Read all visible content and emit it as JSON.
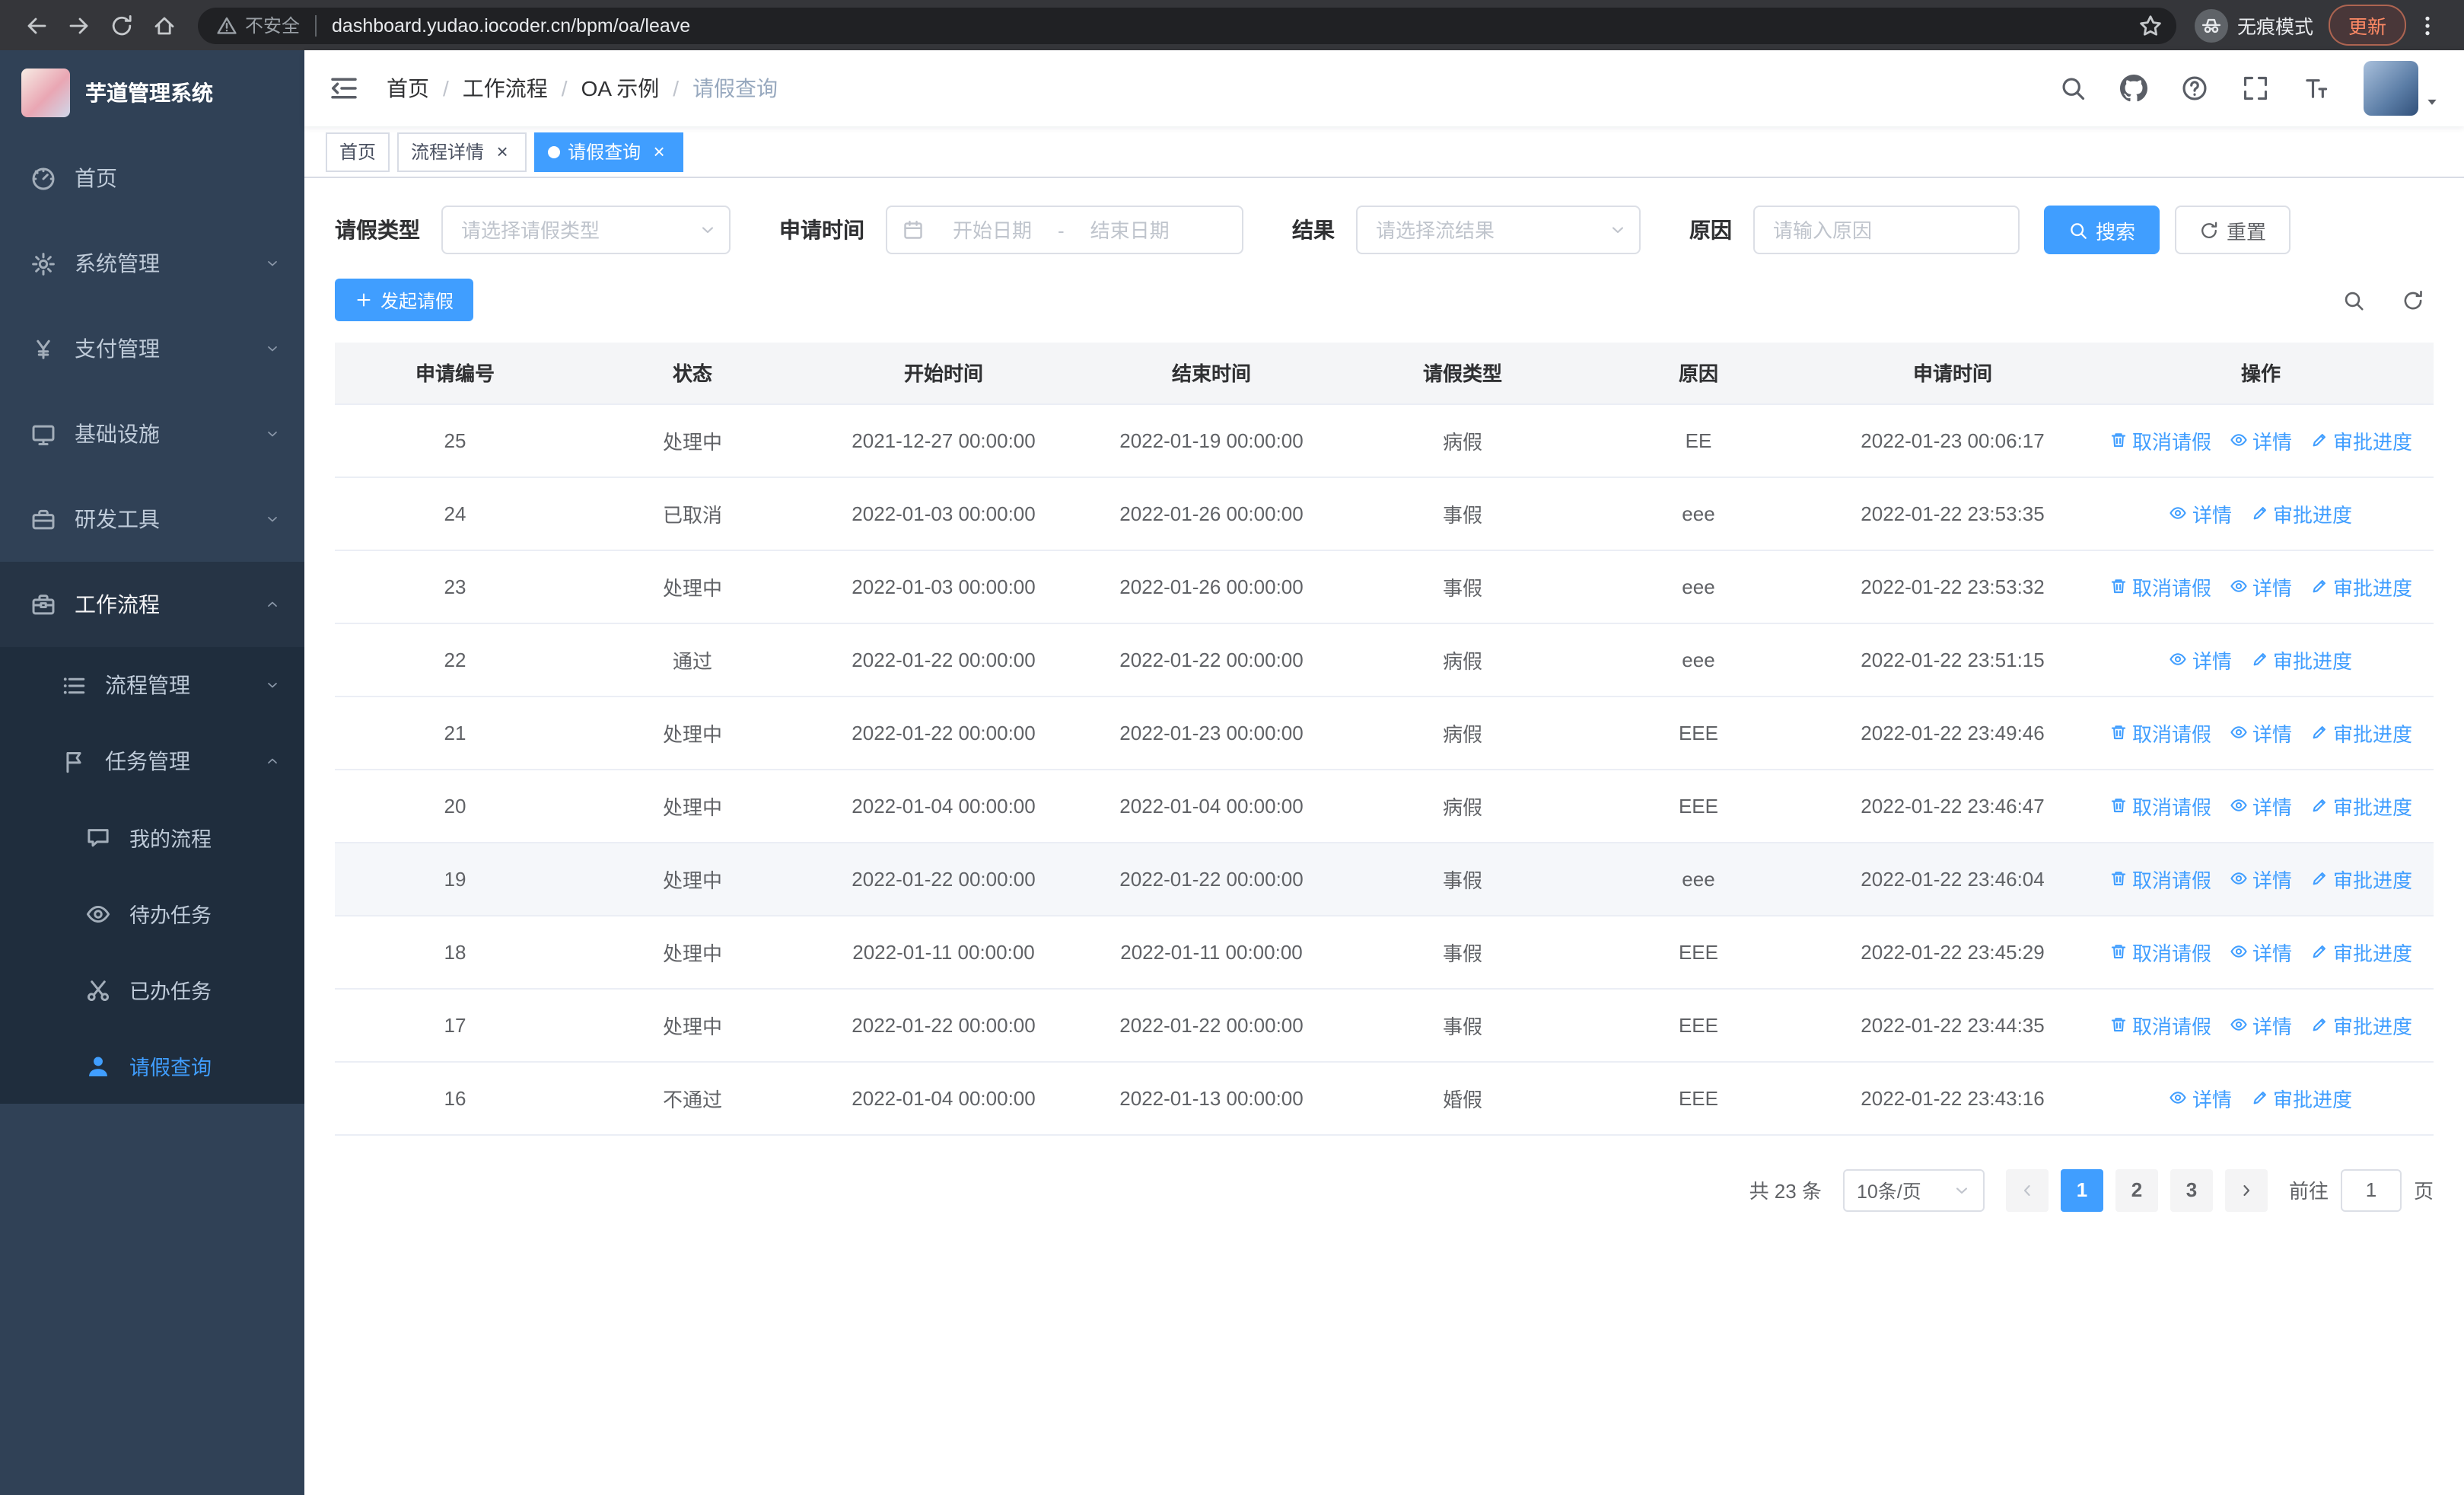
{
  "colors": {
    "accent": "#409eff",
    "sidebar_bg": "#304156",
    "submenu_bg": "#1f2d3d",
    "update_chip": "#ff8a65"
  },
  "browser": {
    "security_label": "不安全",
    "url": "dashboard.yudao.iocoder.cn/bpm/oa/leave",
    "incognito_label": "无痕模式",
    "update_label": "更新"
  },
  "sidebar": {
    "logo_title": "芋道管理系统",
    "menu": [
      {
        "key": "home",
        "label": "首页",
        "icon": "dashboard-icon",
        "level": 1
      },
      {
        "key": "system",
        "label": "系统管理",
        "icon": "gear-icon",
        "level": 1,
        "chevron": "down"
      },
      {
        "key": "payment",
        "label": "支付管理",
        "icon": "yen-icon",
        "level": 1,
        "chevron": "down"
      },
      {
        "key": "infrastructure",
        "label": "基础设施",
        "icon": "monitor-icon",
        "level": 1,
        "chevron": "down"
      },
      {
        "key": "devtools",
        "label": "研发工具",
        "icon": "toolbox-icon",
        "level": 1,
        "chevron": "down"
      },
      {
        "key": "workflow",
        "label": "工作流程",
        "icon": "briefcase-icon",
        "level": 1,
        "chevron": "up",
        "expanded": true
      },
      {
        "key": "process-management",
        "label": "流程管理",
        "icon": "flow-icon",
        "level": 2,
        "chevron": "down"
      },
      {
        "key": "task-management",
        "label": "任务管理",
        "icon": "tasks-icon",
        "level": 2,
        "chevron": "up",
        "expanded": true
      },
      {
        "key": "my-processes",
        "label": "我的流程",
        "icon": "chat-icon",
        "level": 3
      },
      {
        "key": "todo-tasks",
        "label": "待办任务",
        "icon": "eye-icon",
        "level": 3
      },
      {
        "key": "done-tasks",
        "label": "已办任务",
        "icon": "scissors-icon",
        "level": 3
      },
      {
        "key": "leave-query",
        "label": "请假查询",
        "icon": "user-icon",
        "level": 3,
        "active": true
      }
    ]
  },
  "header": {
    "breadcrumb": [
      "首页",
      "工作流程",
      "OA 示例",
      "请假查询"
    ],
    "breadcrumb_separator": "/"
  },
  "tabs": [
    {
      "key": "home",
      "label": "首页",
      "closable": false,
      "active": false
    },
    {
      "key": "process-detail",
      "label": "流程详情",
      "closable": true,
      "active": false
    },
    {
      "key": "leave-query",
      "label": "请假查询",
      "closable": true,
      "active": true
    }
  ],
  "filters": {
    "leave_type_label": "请假类型",
    "leave_type_placeholder": "请选择请假类型",
    "apply_time_label": "申请时间",
    "start_placeholder": "开始日期",
    "range_separator": "-",
    "end_placeholder": "结束日期",
    "result_label": "结果",
    "result_placeholder": "请选择流结果",
    "reason_label": "原因",
    "reason_placeholder": "请输入原因",
    "search_label": "搜索",
    "reset_label": "重置"
  },
  "toolbar": {
    "create_label": "发起请假"
  },
  "table": {
    "columns": [
      "申请编号",
      "状态",
      "开始时间",
      "结束时间",
      "请假类型",
      "原因",
      "申请时间",
      "操作"
    ],
    "action_labels": {
      "cancel": "取消请假",
      "detail": "详情",
      "progress": "审批进度"
    },
    "rows": [
      {
        "id": "25",
        "status": "处理中",
        "start_time": "2021-12-27 00:00:00",
        "end_time": "2022-01-19 00:00:00",
        "leave_type": "病假",
        "reason": "EE",
        "apply_time": "2022-01-23 00:06:17",
        "actions": [
          "cancel",
          "detail",
          "progress"
        ]
      },
      {
        "id": "24",
        "status": "已取消",
        "start_time": "2022-01-03 00:00:00",
        "end_time": "2022-01-26 00:00:00",
        "leave_type": "事假",
        "reason": "eee",
        "apply_time": "2022-01-22 23:53:35",
        "actions": [
          "detail",
          "progress"
        ]
      },
      {
        "id": "23",
        "status": "处理中",
        "start_time": "2022-01-03 00:00:00",
        "end_time": "2022-01-26 00:00:00",
        "leave_type": "事假",
        "reason": "eee",
        "apply_time": "2022-01-22 23:53:32",
        "actions": [
          "cancel",
          "detail",
          "progress"
        ]
      },
      {
        "id": "22",
        "status": "通过",
        "start_time": "2022-01-22 00:00:00",
        "end_time": "2022-01-22 00:00:00",
        "leave_type": "病假",
        "reason": "eee",
        "apply_time": "2022-01-22 23:51:15",
        "actions": [
          "detail",
          "progress"
        ]
      },
      {
        "id": "21",
        "status": "处理中",
        "start_time": "2022-01-22 00:00:00",
        "end_time": "2022-01-23 00:00:00",
        "leave_type": "病假",
        "reason": "EEE",
        "apply_time": "2022-01-22 23:49:46",
        "actions": [
          "cancel",
          "detail",
          "progress"
        ]
      },
      {
        "id": "20",
        "status": "处理中",
        "start_time": "2022-01-04 00:00:00",
        "end_time": "2022-01-04 00:00:00",
        "leave_type": "病假",
        "reason": "EEE",
        "apply_time": "2022-01-22 23:46:47",
        "actions": [
          "cancel",
          "detail",
          "progress"
        ]
      },
      {
        "id": "19",
        "status": "处理中",
        "start_time": "2022-01-22 00:00:00",
        "end_time": "2022-01-22 00:00:00",
        "leave_type": "事假",
        "reason": "eee",
        "apply_time": "2022-01-22 23:46:04",
        "actions": [
          "cancel",
          "detail",
          "progress"
        ],
        "highlighted": true
      },
      {
        "id": "18",
        "status": "处理中",
        "start_time": "2022-01-11 00:00:00",
        "end_time": "2022-01-11 00:00:00",
        "leave_type": "事假",
        "reason": "EEE",
        "apply_time": "2022-01-22 23:45:29",
        "actions": [
          "cancel",
          "detail",
          "progress"
        ]
      },
      {
        "id": "17",
        "status": "处理中",
        "start_time": "2022-01-22 00:00:00",
        "end_time": "2022-01-22 00:00:00",
        "leave_type": "事假",
        "reason": "EEE",
        "apply_time": "2022-01-22 23:44:35",
        "actions": [
          "cancel",
          "detail",
          "progress"
        ]
      },
      {
        "id": "16",
        "status": "不通过",
        "start_time": "2022-01-04 00:00:00",
        "end_time": "2022-01-13 00:00:00",
        "leave_type": "婚假",
        "reason": "EEE",
        "apply_time": "2022-01-22 23:43:16",
        "actions": [
          "detail",
          "progress"
        ]
      }
    ]
  },
  "pagination": {
    "total_label": "共 23 条",
    "page_size_label": "10条/页",
    "pages": [
      "1",
      "2",
      "3"
    ],
    "active_page": "1",
    "goto_prefix": "前往",
    "goto_value": "1",
    "goto_suffix": "页"
  }
}
